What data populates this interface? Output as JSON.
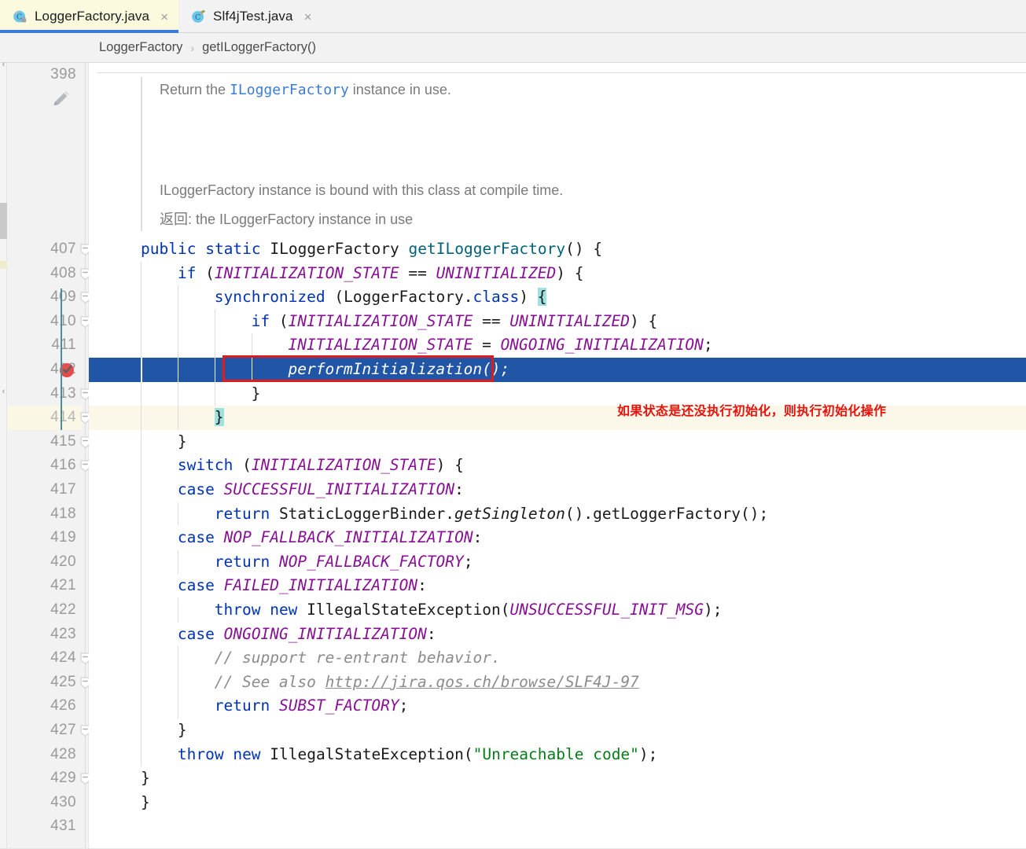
{
  "window": {
    "app": "IntelliJ IDEA Editor",
    "colors": {
      "selection_blue": "#2155a5",
      "caret_line": "#fbf8e9",
      "tab_active_bg": "#fbfadf",
      "tab_underline": "#3b7bd6",
      "annotation_red": "#e8120c",
      "keyword_blue": "#0033b3",
      "constant_purple": "#871094",
      "string_green": "#067d17",
      "comment_gray": "#8c8c8c",
      "method_teal": "#00627a",
      "brace_match_cyan": "#9fe0e0",
      "brace_rail_teal": "#4a8e99",
      "gutter_bg": "#f2f2f2"
    }
  },
  "tabs": [
    {
      "label": "LoggerFactory.java",
      "icon": "java-class-locked-icon",
      "close": "×",
      "active": true
    },
    {
      "label": "Slf4jTest.java",
      "icon": "java-class-runnable-icon",
      "close": "×",
      "active": false
    }
  ],
  "breadcrumb": {
    "items": [
      "LoggerFactory",
      "getILoggerFactory()"
    ],
    "separator": "›"
  },
  "javadoc": {
    "edit_icon": "pencil-icon",
    "line1_pre": "Return the ",
    "line1_link": "ILoggerFactory",
    "line1_post": " instance in use.",
    "line2": "ILoggerFactory instance is bound with this class at compile time.",
    "line3": "返回: the ILoggerFactory instance in use"
  },
  "annotation": {
    "text": "如果状态是还没执行初始化，则执行初始化操作",
    "box_target": "performInitialization();"
  },
  "gutter": {
    "first_line": "398",
    "breakpoint_line": "412",
    "breakpoint_icon": "breakpoint-verified-icon"
  },
  "code": {
    "lines": [
      {
        "n": "398",
        "tokens": []
      },
      {
        "n": "407",
        "indent": 0,
        "fold": true,
        "tokens": [
          {
            "t": "public",
            "c": "kw"
          },
          {
            "t": " ",
            "c": "plain"
          },
          {
            "t": "static",
            "c": "kw"
          },
          {
            "t": " ",
            "c": "plain"
          },
          {
            "t": "ILoggerFactory",
            "c": "plain"
          },
          {
            "t": " ",
            "c": "plain"
          },
          {
            "t": "getILoggerFactory",
            "c": "mth"
          },
          {
            "t": "() {",
            "c": "plain"
          }
        ]
      },
      {
        "n": "408",
        "indent": 1,
        "fold": true,
        "tokens": [
          {
            "t": "if",
            "c": "kw"
          },
          {
            "t": " (",
            "c": "plain"
          },
          {
            "t": "INITIALIZATION_STATE",
            "c": "cnst"
          },
          {
            "t": " == ",
            "c": "plain"
          },
          {
            "t": "UNINITIALIZED",
            "c": "cnst"
          },
          {
            "t": ") {",
            "c": "plain"
          }
        ]
      },
      {
        "n": "409",
        "indent": 2,
        "fold": true,
        "tokens": [
          {
            "t": "synchronized",
            "c": "kw"
          },
          {
            "t": " (LoggerFactory.",
            "c": "plain"
          },
          {
            "t": "class",
            "c": "fld"
          },
          {
            "t": ") ",
            "c": "plain"
          },
          {
            "t": "{",
            "c": "plain",
            "brace": true
          }
        ]
      },
      {
        "n": "410",
        "indent": 3,
        "fold": true,
        "tokens": [
          {
            "t": "if",
            "c": "kw"
          },
          {
            "t": " (",
            "c": "plain"
          },
          {
            "t": "INITIALIZATION_STATE",
            "c": "cnst"
          },
          {
            "t": " == ",
            "c": "plain"
          },
          {
            "t": "UNINITIALIZED",
            "c": "cnst"
          },
          {
            "t": ") {",
            "c": "plain"
          }
        ]
      },
      {
        "n": "411",
        "indent": 4,
        "tokens": [
          {
            "t": "INITIALIZATION_STATE",
            "c": "cnst"
          },
          {
            "t": " = ",
            "c": "plain"
          },
          {
            "t": "ONGOING_INITIALIZATION",
            "c": "cnst"
          },
          {
            "t": ";",
            "c": "plain"
          }
        ]
      },
      {
        "n": "412",
        "indent": 4,
        "selected": true,
        "breakpoint": true,
        "tokens": [
          {
            "t": "performInitialization",
            "c": "stat"
          },
          {
            "t": "();",
            "c": "stat"
          }
        ]
      },
      {
        "n": "413",
        "indent": 3,
        "fold": true,
        "tokens": [
          {
            "t": "}",
            "c": "plain"
          }
        ]
      },
      {
        "n": "414",
        "indent": 2,
        "caret": true,
        "fold": true,
        "tokens": [
          {
            "t": "}",
            "c": "plain",
            "brace": true
          }
        ]
      },
      {
        "n": "415",
        "indent": 1,
        "fold": true,
        "tokens": [
          {
            "t": "}",
            "c": "plain"
          }
        ]
      },
      {
        "n": "416",
        "indent": 1,
        "fold": true,
        "tokens": [
          {
            "t": "switch",
            "c": "kw"
          },
          {
            "t": " (",
            "c": "plain"
          },
          {
            "t": "INITIALIZATION_STATE",
            "c": "cnst"
          },
          {
            "t": ") {",
            "c": "plain"
          }
        ]
      },
      {
        "n": "417",
        "indent": 1,
        "tokens": [
          {
            "t": "case",
            "c": "kw"
          },
          {
            "t": " ",
            "c": "plain"
          },
          {
            "t": "SUCCESSFUL_INITIALIZATION",
            "c": "cnst"
          },
          {
            "t": ":",
            "c": "plain"
          }
        ]
      },
      {
        "n": "418",
        "indent": 2,
        "tokens": [
          {
            "t": "return",
            "c": "kw"
          },
          {
            "t": " StaticLoggerBinder.",
            "c": "plain"
          },
          {
            "t": "getSingleton",
            "c": "stat"
          },
          {
            "t": "().getLoggerFactory();",
            "c": "plain"
          }
        ]
      },
      {
        "n": "419",
        "indent": 1,
        "tokens": [
          {
            "t": "case",
            "c": "kw"
          },
          {
            "t": " ",
            "c": "plain"
          },
          {
            "t": "NOP_FALLBACK_INITIALIZATION",
            "c": "cnst"
          },
          {
            "t": ":",
            "c": "plain"
          }
        ]
      },
      {
        "n": "420",
        "indent": 2,
        "tokens": [
          {
            "t": "return",
            "c": "kw"
          },
          {
            "t": " ",
            "c": "plain"
          },
          {
            "t": "NOP_FALLBACK_FACTORY",
            "c": "cnst"
          },
          {
            "t": ";",
            "c": "plain"
          }
        ]
      },
      {
        "n": "421",
        "indent": 1,
        "tokens": [
          {
            "t": "case",
            "c": "kw"
          },
          {
            "t": " ",
            "c": "plain"
          },
          {
            "t": "FAILED_INITIALIZATION",
            "c": "cnst"
          },
          {
            "t": ":",
            "c": "plain"
          }
        ]
      },
      {
        "n": "422",
        "indent": 2,
        "tokens": [
          {
            "t": "throw",
            "c": "kw"
          },
          {
            "t": " ",
            "c": "plain"
          },
          {
            "t": "new",
            "c": "kw"
          },
          {
            "t": " IllegalStateException(",
            "c": "plain"
          },
          {
            "t": "UNSUCCESSFUL_INIT_MSG",
            "c": "cnst"
          },
          {
            "t": ");",
            "c": "plain"
          }
        ]
      },
      {
        "n": "423",
        "indent": 1,
        "tokens": [
          {
            "t": "case",
            "c": "kw"
          },
          {
            "t": " ",
            "c": "plain"
          },
          {
            "t": "ONGOING_INITIALIZATION",
            "c": "cnst"
          },
          {
            "t": ":",
            "c": "plain"
          }
        ]
      },
      {
        "n": "424",
        "indent": 2,
        "fold": true,
        "tokens": [
          {
            "t": "// support re-entrant behavior.",
            "c": "cmt"
          }
        ]
      },
      {
        "n": "425",
        "indent": 2,
        "fold": true,
        "tokens": [
          {
            "t": "// See also ",
            "c": "cmt"
          },
          {
            "t": "http://jira.qos.ch/browse/SLF4J-97",
            "c": "lnk"
          }
        ]
      },
      {
        "n": "426",
        "indent": 2,
        "tokens": [
          {
            "t": "return",
            "c": "kw"
          },
          {
            "t": " ",
            "c": "plain"
          },
          {
            "t": "SUBST_FACTORY",
            "c": "cnst"
          },
          {
            "t": ";",
            "c": "plain"
          }
        ]
      },
      {
        "n": "427",
        "indent": 1,
        "fold": true,
        "tokens": [
          {
            "t": "}",
            "c": "plain"
          }
        ]
      },
      {
        "n": "428",
        "indent": 1,
        "tokens": [
          {
            "t": "throw",
            "c": "kw"
          },
          {
            "t": " ",
            "c": "plain"
          },
          {
            "t": "new",
            "c": "kw"
          },
          {
            "t": " IllegalStateException(",
            "c": "plain"
          },
          {
            "t": "\"Unreachable code\"",
            "c": "str"
          },
          {
            "t": ");",
            "c": "plain"
          }
        ]
      },
      {
        "n": "429",
        "indent": 0,
        "fold": true,
        "tokens": [
          {
            "t": "}",
            "c": "plain"
          }
        ]
      },
      {
        "n": "430",
        "indent": -1,
        "tokens": [
          {
            "t": "}",
            "c": "plain"
          }
        ]
      },
      {
        "n": "431",
        "indent": 0,
        "tokens": []
      }
    ]
  }
}
